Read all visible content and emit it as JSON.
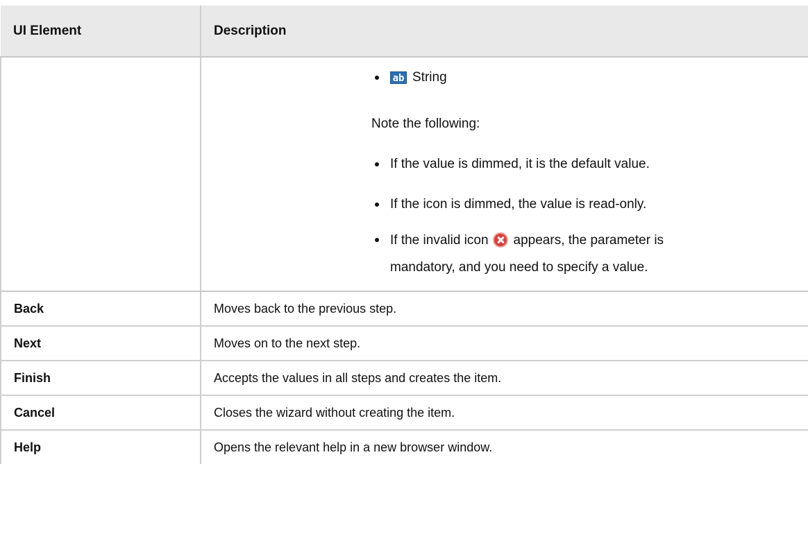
{
  "header": {
    "col1": "UI Element",
    "col2": "Description"
  },
  "description_block": {
    "string_item": {
      "icon": "ab-string-icon",
      "label": "String"
    },
    "note_intro": "Note the following:",
    "bullets": [
      "If the value is dimmed, it is the default value.",
      "If the icon is dimmed, the value is read-only."
    ],
    "invalid_bullet": {
      "prefix": "If the invalid icon",
      "icon": "invalid-icon",
      "suffix": "appears, the parameter is",
      "line2": "mandatory, and you need to specify a value."
    }
  },
  "rows": [
    {
      "element": "Back",
      "description": "Moves back to the previous step."
    },
    {
      "element": "Next",
      "description": "Moves on to the next step."
    },
    {
      "element": "Finish",
      "description": "Accepts the values in all steps and creates the item."
    },
    {
      "element": "Cancel",
      "description": "Closes the wizard without creating the item."
    },
    {
      "element": "Help",
      "description": "Opens the relevant help in a new browser window."
    }
  ]
}
